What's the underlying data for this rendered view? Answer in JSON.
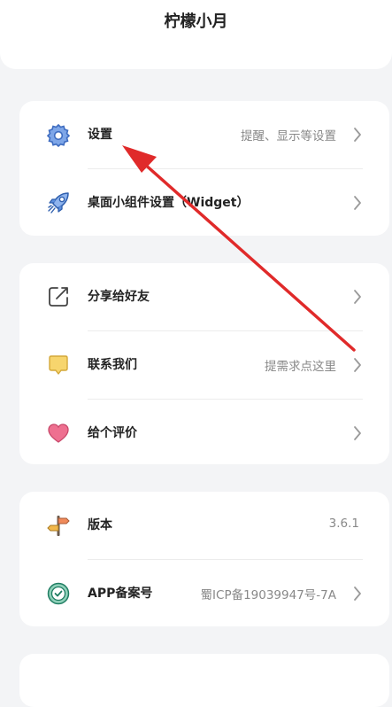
{
  "app": {
    "title": "柠檬小月"
  },
  "sections": {
    "s1": {
      "settings": {
        "label": "设置",
        "value": "提醒、显示等设置",
        "icon": "gear-icon"
      },
      "widget": {
        "label": "桌面小组件设置（Widget）",
        "icon": "rocket-icon"
      }
    },
    "s2": {
      "share": {
        "label": "分享给好友",
        "icon": "share-icon"
      },
      "contact": {
        "label": "联系我们",
        "value": "提需求点这里",
        "icon": "chat-bubble-icon"
      },
      "rate": {
        "label": "给个评价",
        "icon": "heart-icon"
      }
    },
    "s3": {
      "version": {
        "label": "版本",
        "value": "3.6.1",
        "icon": "signpost-icon"
      },
      "icp": {
        "label": "APP备案号",
        "value": "蜀ICP备19039947号-7A",
        "icon": "verified-badge-icon"
      }
    }
  },
  "colors": {
    "background": "#f3f4f6",
    "card": "#ffffff",
    "gear": "#4e7fd6",
    "rocket": "#3d74c9",
    "chat": "#f5d36b",
    "heart": "#ec6d8a",
    "badge": "#2e9c7d",
    "annotation_arrow": "#e02a2a"
  }
}
